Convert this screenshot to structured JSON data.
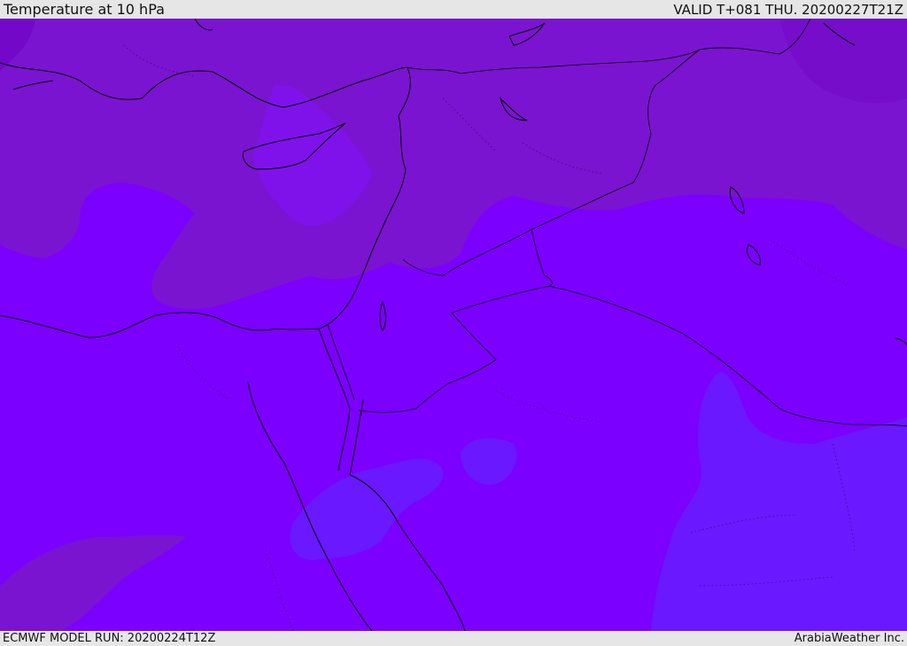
{
  "header": {
    "title": "Temperature at 10 hPa",
    "valid": "VALID T+081 THU. 20200227T21Z"
  },
  "footer": {
    "model_run": "ECMWF MODEL RUN: 20200224T12Z",
    "credit": "ArabiaWeather Inc."
  },
  "colors": {
    "background_field": "#7b00ff",
    "darker_band": "#7a14d0",
    "darkest_band": "#6e00c4",
    "lighter_band": "#8410ff",
    "cool_band": "#6a18ff",
    "border_line": "#000000"
  }
}
